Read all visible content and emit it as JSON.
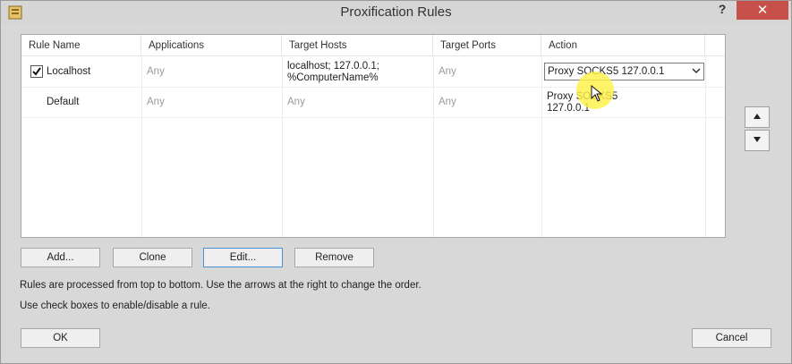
{
  "window": {
    "title": "Proxification Rules",
    "help_label": "?",
    "close_label": "✕"
  },
  "table": {
    "columns": [
      "Rule Name",
      "Applications",
      "Target Hosts",
      "Target Ports",
      "Action"
    ],
    "rows": [
      {
        "checked": true,
        "name": "Localhost",
        "applications": "Any",
        "hosts_line1": "localhost; 127.0.0.1;",
        "hosts_line2": "%ComputerName%",
        "ports": "Any",
        "action": "Proxy SOCKS5 127.0.0.1"
      },
      {
        "checked": false,
        "name": "Default",
        "applications": "Any",
        "hosts": "Any",
        "ports": "Any",
        "action_line1": "Proxy SOCKS5",
        "action_line2": "127.0.0.1"
      }
    ]
  },
  "buttons": {
    "add": "Add...",
    "clone": "Clone",
    "edit": "Edit...",
    "remove": "Remove",
    "ok": "OK",
    "cancel": "Cancel"
  },
  "side": {
    "up_icon": "triangle-up",
    "down_icon": "triangle-down"
  },
  "info": {
    "line1": "Rules are processed from top to bottom. Use the arrows at the right to change the order.",
    "line2": "Use check boxes to enable/disable a rule."
  },
  "colors": {
    "close_bg": "#c7504a",
    "cursor_highlight": "#fff046",
    "focus_border": "#4a90d9"
  }
}
